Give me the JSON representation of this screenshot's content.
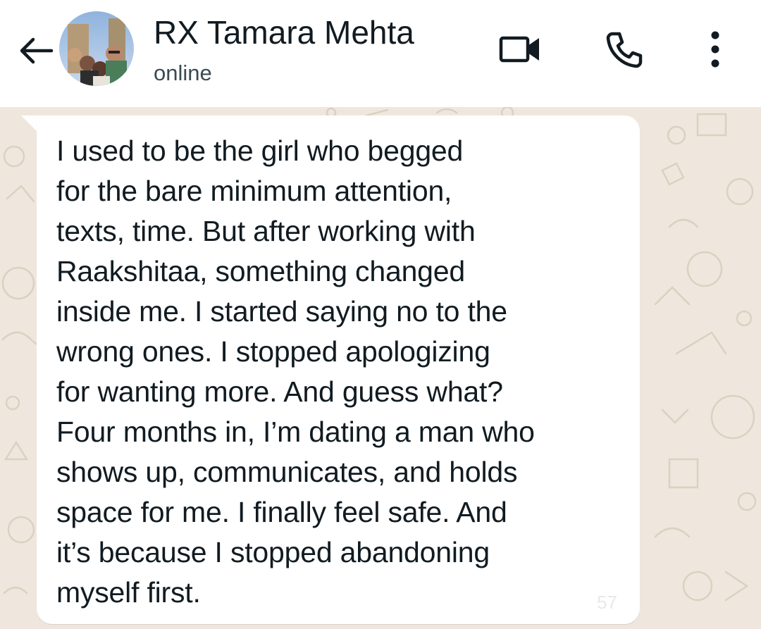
{
  "header": {
    "contact_name": "RX Tamara Mehta",
    "status": "online",
    "icons": {
      "back": "back-arrow-icon",
      "video": "video-camera-icon",
      "call": "phone-icon",
      "menu": "more-vertical-icon"
    }
  },
  "message": {
    "text": "I used to be the girl who begged\nfor the bare minimum attention,\ntexts, time. But after working with\nRaakshitaa, something changed\ninside me. I started saying no to the\nwrong ones. I stopped apologizing\nfor wanting more. And guess what?\nFour months in, I’m dating a man who\nshows up, communicates, and holds\nspace for me. I finally feel safe. And\nit’s because I stopped abandoning\nmyself first.",
    "time": "57"
  },
  "colors": {
    "chat_background": "#efe7dd",
    "bubble": "#ffffff",
    "text_primary": "#111b21",
    "text_secondary": "#3b4a54"
  }
}
